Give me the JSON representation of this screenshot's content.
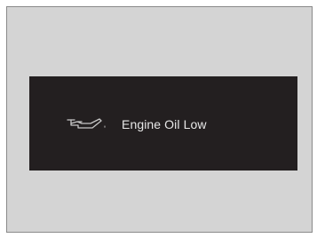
{
  "display": {
    "icon": "oil-can-icon",
    "message": "Engine Oil Low",
    "colors": {
      "frame_background": "#d4d4d4",
      "panel_background": "#231f20",
      "text": "#e8e8e8",
      "icon": "#c8c8c8"
    }
  }
}
